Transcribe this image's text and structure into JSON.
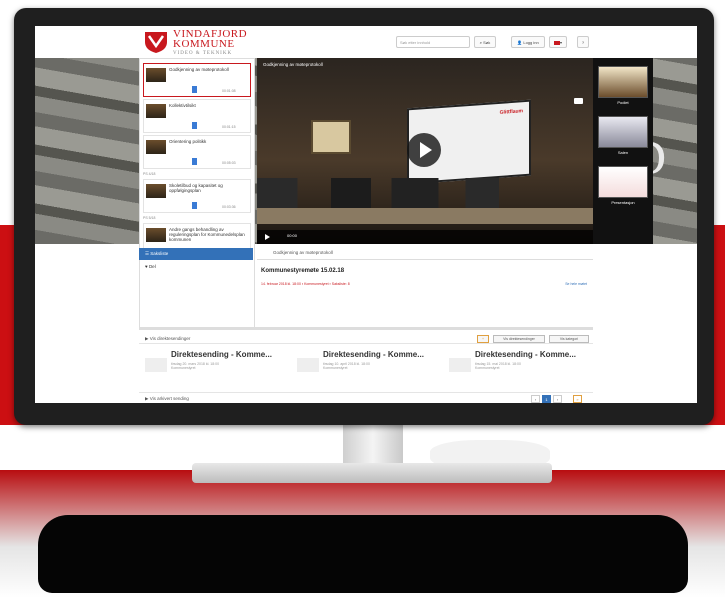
{
  "header": {
    "logo_line1": "VINDAFJORD",
    "logo_line2": "KOMMUNE",
    "logo_line3": "VIDEO & TEKNIKK",
    "search_placeholder": "Søk etter innhold",
    "search_button": "Søk",
    "login_button": "Logg inn",
    "language": "",
    "help_button": "?"
  },
  "hero_letter": "D",
  "playlist": {
    "items": [
      {
        "title": "Godkjenning av møteprotokoll",
        "time": "00:01:08"
      },
      {
        "title": "Kollektivtilsikt",
        "time": "00:01:15"
      },
      {
        "title": "Orientering politikk",
        "time": "00:05:03"
      },
      {
        "title": "Skoletilbud og kapasitet og oppfølgingsplan",
        "time": "00:03:36"
      },
      {
        "title": "Andre gangs behandling av reguleringsplan for Kommunedelsplan kommunen",
        "time": "00:10:14"
      }
    ],
    "item_labels": [
      "PS 4/18",
      "PS 5/18"
    ],
    "tab_active": "Saksliste",
    "tab_other": "Del"
  },
  "video": {
    "title": "Godkjenning av møteprotokoll",
    "screen_brand": "Glittflaum",
    "time": "00:00"
  },
  "right_thumbs": [
    "Podiet",
    "Salen",
    "Presentasjon"
  ],
  "video_info": {
    "bar_label": "Godkjenning av møteprotokoll",
    "title": "Kommunestyremøte 15.02.18",
    "meta": "14. februar 2018 kl. 18:00  ▪ Kommunestyret  ▪ Saksliste: 8",
    "right_link": "Se hele møtet"
  },
  "direct": {
    "heading": "Vis direktesendinger",
    "btn_1": "+",
    "btn_2": "Vis direktesendinger",
    "btn_3": "Vis kategori",
    "cards": [
      {
        "title": "Direktesending - Komme...",
        "sub1": "tirsdag 20. mars 2018 kl. 18:00",
        "sub2": "Kommunestyret"
      },
      {
        "title": "Direktesending - Komme...",
        "sub1": "tirsdag 10. april 2018 kl. 18:00",
        "sub2": "Kommunestyret"
      },
      {
        "title": "Direktesending - Komme...",
        "sub1": "tirsdag 15. mai 2018 kl. 18:00",
        "sub2": "Kommunestyret"
      }
    ]
  },
  "archive": {
    "heading": "Vis arkivert sending",
    "pages": [
      "‹",
      "1",
      "›",
      "»"
    ]
  }
}
